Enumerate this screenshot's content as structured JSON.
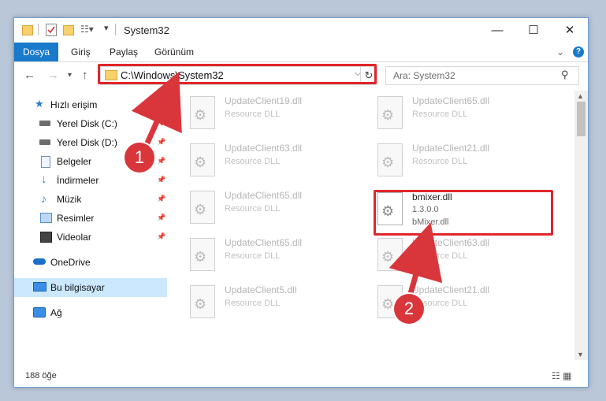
{
  "window": {
    "title": "System32",
    "controls": {
      "minimize": "—",
      "maximize": "☐",
      "close": "✕"
    }
  },
  "quick_access_icons": [
    "folder-icon",
    "properties-icon",
    "new-folder-icon",
    "customize-icon"
  ],
  "ribbon": {
    "tabs": [
      "Dosya",
      "Giriş",
      "Paylaş",
      "Görünüm"
    ],
    "help": "?"
  },
  "address": {
    "path": "C:\\Windows\\System32",
    "search_placeholder": "Ara: System32"
  },
  "sidebar": {
    "items": [
      {
        "label": "Hızlı erişim",
        "icon": "star-icon",
        "pinned": false
      },
      {
        "label": "Yerel Disk (C:)",
        "icon": "drive-icon",
        "pinned": true
      },
      {
        "label": "Yerel Disk (D:)",
        "icon": "drive-icon",
        "pinned": true
      },
      {
        "label": "Belgeler",
        "icon": "documents-icon",
        "pinned": true
      },
      {
        "label": "İndirmeler",
        "icon": "download-icon",
        "pinned": true
      },
      {
        "label": "Müzik",
        "icon": "music-icon",
        "pinned": true
      },
      {
        "label": "Resimler",
        "icon": "pictures-icon",
        "pinned": true
      },
      {
        "label": "Videolar",
        "icon": "videos-icon",
        "pinned": true
      },
      {
        "label": "OneDrive",
        "icon": "cloud-icon",
        "pinned": false
      },
      {
        "label": "Bu bilgisayar",
        "icon": "computer-icon",
        "pinned": false,
        "selected": true
      },
      {
        "label": "Ağ",
        "icon": "network-icon",
        "pinned": false
      }
    ]
  },
  "files": [
    {
      "name": "UpdateClient19.dll",
      "type": "Resource DLL"
    },
    {
      "name": "UpdateClient65.dll",
      "type": "Resource DLL"
    },
    {
      "name": "UpdateClient63.dll",
      "type": "Resource DLL"
    },
    {
      "name": "UpdateClient21.dll",
      "type": "Resource DLL"
    },
    {
      "name": "UpdateClient65.dll",
      "type": "Resource DLL"
    },
    {
      "name": "bmixer.dll",
      "version": "1.3.0.0",
      "description": "bMixer.dll",
      "highlighted": true
    },
    {
      "name": "UpdateClient65.dll",
      "type": "Resource DLL"
    },
    {
      "name": "UpdateClient63.dll",
      "type": "Resource DLL"
    },
    {
      "name": "UpdateClient5.dll",
      "type": "Resource DLL"
    },
    {
      "name": "UpdateClient21.dll",
      "type": "Resource DLL"
    }
  ],
  "status": {
    "item_count": "188 öğe"
  },
  "annotations": {
    "step1": "1",
    "step2": "2",
    "color": "#d9363c"
  }
}
